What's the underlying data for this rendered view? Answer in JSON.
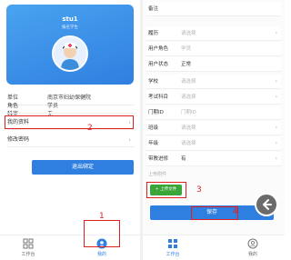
{
  "left": {
    "profile": {
      "username": "stu1",
      "role_text": "报名学生"
    },
    "rows": [
      {
        "key": "单位",
        "value": "南京市妇幼保健院"
      },
      {
        "key": "科室",
        "value": "无"
      },
      {
        "key": "角色",
        "value": "学员"
      },
      {
        "key": "我的资料",
        "value": ""
      },
      {
        "key": "修改密码",
        "value": ""
      }
    ],
    "logout_label": "退出绑定",
    "tabs": [
      {
        "label": "工作台"
      },
      {
        "label": "我的"
      }
    ],
    "annotations": {
      "n1": "1",
      "n2": "2"
    }
  },
  "right": {
    "rows": [
      {
        "key": "备注",
        "value": ""
      },
      {
        "key": "履历",
        "value": "请选择"
      },
      {
        "key": "用户角色",
        "value": "学员"
      },
      {
        "key": "用户状态",
        "value": "正常"
      },
      {
        "key": "学校",
        "value": "请选择"
      },
      {
        "key": "考试科目",
        "value": "请选择"
      },
      {
        "key": "门期ID",
        "value": "门期ID"
      },
      {
        "key": "班级",
        "value": "请选择"
      },
      {
        "key": "年级",
        "value": "请选择"
      },
      {
        "key": "带教进修",
        "value": "有"
      }
    ],
    "upload_section_label": "上传附件",
    "upload_button": "+ 上传文件",
    "save_label": "保存",
    "tabs": [
      {
        "label": "工作台"
      },
      {
        "label": "我的"
      }
    ],
    "annotations": {
      "n3": "3",
      "n4": "4"
    }
  },
  "colors": {
    "primary": "#2f7fe0",
    "upload_green": "#3aa63a",
    "annotation_red": "#e02020"
  }
}
